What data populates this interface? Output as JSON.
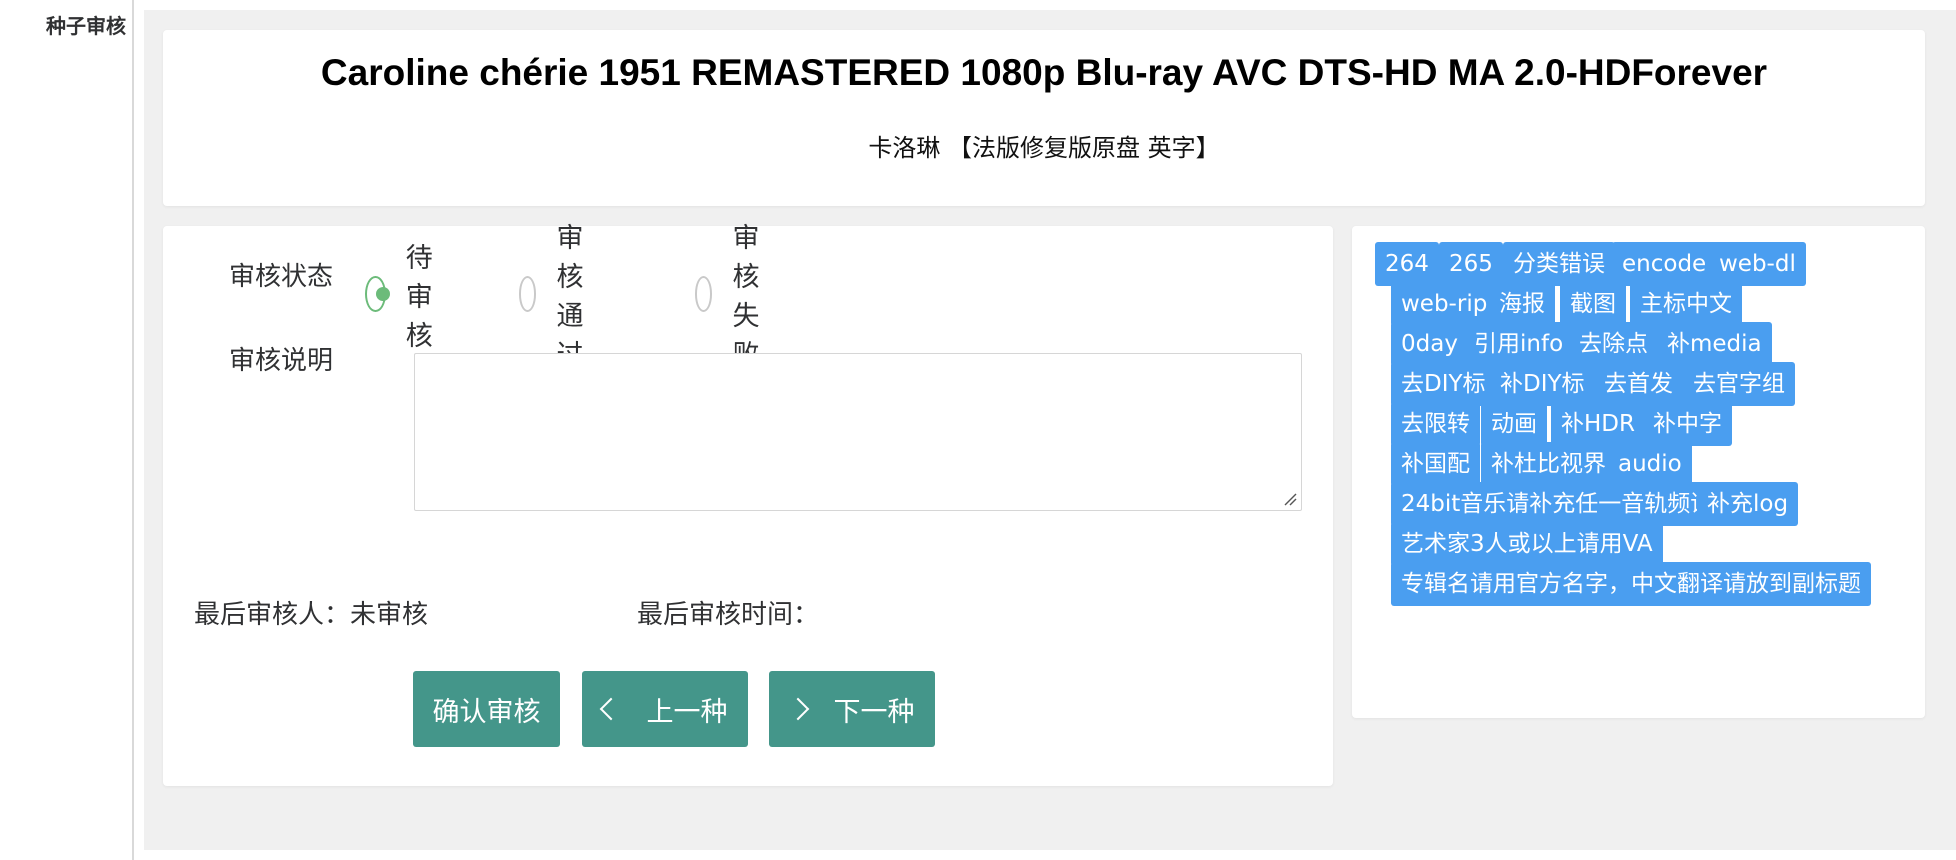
{
  "sidebar": {
    "title": "种子审核"
  },
  "torrent": {
    "title": "Caroline chérie 1951 REMASTERED 1080p Blu-ray AVC DTS-HD MA 2.0-HDForever",
    "subtitle": "卡洛琳 【法版修复版原盘 英字】"
  },
  "form": {
    "status_label": "审核状态",
    "status_options": [
      {
        "label": "待审核",
        "checked": true
      },
      {
        "label": "审核通过",
        "checked": false
      },
      {
        "label": "审核失败",
        "checked": false
      }
    ],
    "remark_label": "审核说明",
    "remark_value": "",
    "last_reviewer_label": "最后审核人：",
    "last_reviewer_value": "未审核",
    "last_time_label": "最后审核时间：",
    "last_time_value": "",
    "buttons": {
      "confirm": "确认审核",
      "prev": "上一种",
      "next": "下一种"
    }
  },
  "tags": [
    [
      "264",
      "265",
      "分类错误",
      "encode",
      "web-dl"
    ],
    [
      "web-rip",
      "海报",
      "截图",
      "主标中文"
    ],
    [
      "0day",
      "引用info",
      "去除点",
      "补media"
    ],
    [
      "去DIY标",
      "补DIY标",
      "去首发",
      "去官字组"
    ],
    [
      "去限转",
      "动画",
      "补HDR",
      "补中字"
    ],
    [
      "补国配",
      "补杜比视界",
      "audio"
    ],
    [
      "24bit音乐请补充任一音轨频谱图",
      "补充log"
    ],
    [
      "艺术家3人或以上请用VA"
    ],
    [
      "专辑名请用官方名字，中文翻译请放到副标题"
    ]
  ],
  "colors": {
    "primary": "#44968a",
    "tag": "#4a9ef0",
    "radio_checked": "#6cbb7a"
  }
}
